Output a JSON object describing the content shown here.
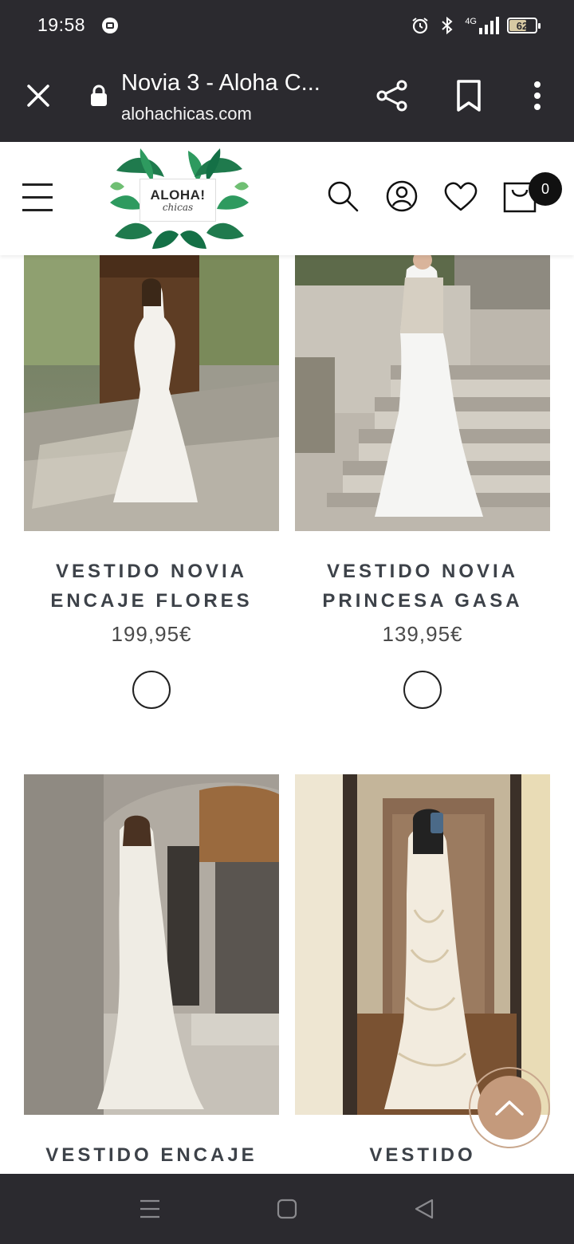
{
  "status_bar": {
    "time": "19:58",
    "network": "4G",
    "battery": "62"
  },
  "browser": {
    "page_title": "Novia 3 - Aloha C...",
    "url": "alohachicas.com"
  },
  "site": {
    "logo_line1": "ALOHA!",
    "logo_line2": "chicas",
    "cart_count": "0"
  },
  "products": [
    {
      "name_line1": "VESTIDO NOVIA",
      "name_line2": "ENCAJE FLORES",
      "price": "199,95€"
    },
    {
      "name_line1": "VESTIDO NOVIA",
      "name_line2": "PRINCESA GASA",
      "price": "139,95€"
    },
    {
      "name_line1": "VESTIDO ENCAJE",
      "name_line2": "",
      "price": ""
    },
    {
      "name_line1": "VESTIDO",
      "name_line2": "",
      "price": ""
    }
  ],
  "colors": {
    "chrome_bg": "#2b2a2f",
    "accent": "#c49a7c",
    "product_text": "#3d4249"
  }
}
